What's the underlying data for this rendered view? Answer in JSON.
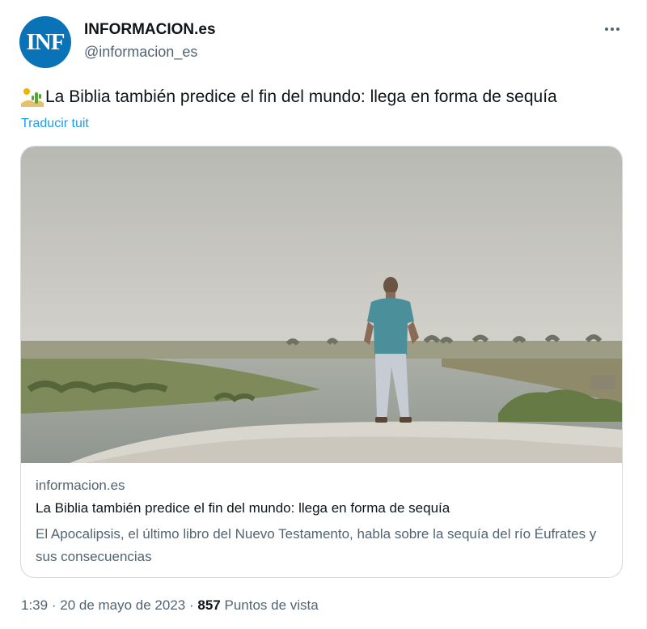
{
  "author": {
    "name": "INFORMACION.es",
    "handle": "@informacion_es",
    "avatar_text": "INF",
    "avatar_color": "#0a73b8"
  },
  "tweet": {
    "emoji": "desert-emoji",
    "text": "La Biblia también predice el fin del mundo: llega en forma de sequía",
    "translate_label": "Traducir tuit"
  },
  "card": {
    "image": "man-standing-by-euphrates-river",
    "domain": "informacion.es",
    "title": "La Biblia también predice el fin del mundo: llega en forma de sequía",
    "description": "El Apocalipsis, el último libro del Nuevo Testamento, habla sobre la sequía del río Éufrates y sus consecuencias"
  },
  "meta": {
    "time": "1:39",
    "separator": "·",
    "date": "20 de mayo de 2023",
    "views_count": "857",
    "views_label": "Puntos de vista"
  },
  "colors": {
    "link": "#1d9bf0",
    "secondary_text": "#536471",
    "primary_text": "#0f1419",
    "border": "#cfd9de"
  }
}
